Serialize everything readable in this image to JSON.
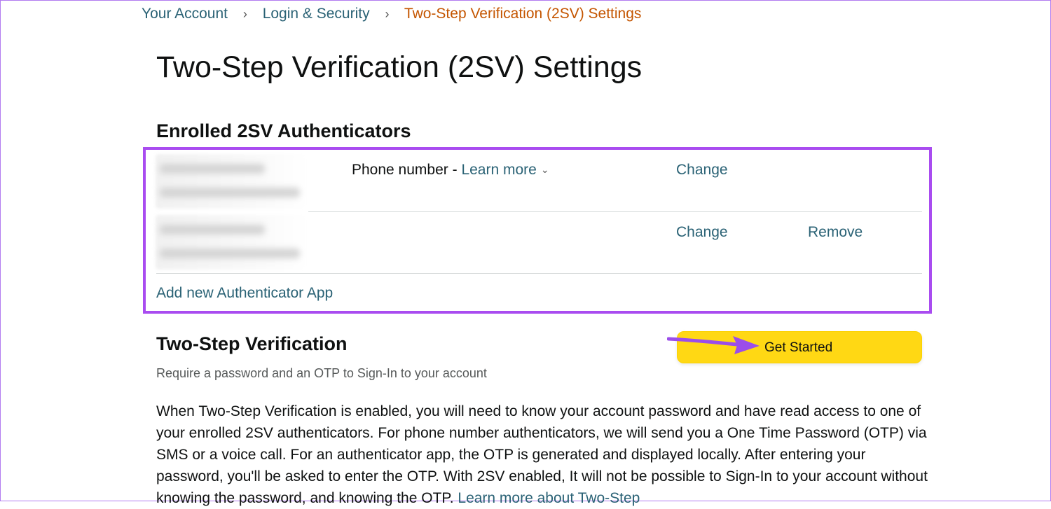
{
  "breadcrumb": {
    "items": [
      {
        "label": "Your Account"
      },
      {
        "label": "Login & Security"
      }
    ],
    "separator": "›",
    "current": "Two-Step Verification (2SV) Settings"
  },
  "page": {
    "title": "Two-Step Verification (2SV) Settings"
  },
  "enrolled": {
    "heading": "Enrolled 2SV Authenticators",
    "rows": [
      {
        "type_label": "Phone number - ",
        "learn_more": "Learn more",
        "change": "Change"
      },
      {
        "change": "Change",
        "remove": "Remove"
      }
    ],
    "add_app": "Add new Authenticator App"
  },
  "tsv": {
    "heading": "Two-Step Verification",
    "subtitle": "Require a password and an OTP to Sign-In to your account",
    "button": "Get Started",
    "description": "When Two-Step Verification is enabled, you will need to know your account password and have read access to one of your enrolled 2SV authenticators. For phone number authenticators, we will send you a One Time Password (OTP) via SMS or a voice call. For an authenticator app, the OTP is generated and displayed locally. After entering your password, you'll be asked to enter the OTP. With 2SV enabled, It will not be possible to Sign-In to your account without knowing the password, and knowing the OTP.",
    "description_link": "Learn more about Two-Step"
  },
  "colors": {
    "link": "#2a6275",
    "current_crumb": "#c45500",
    "highlight": "#a94cf0",
    "button": "#ffd814"
  },
  "icons": {
    "dropdown": "chevron-down-icon",
    "annotation": "arrow-right-icon"
  }
}
